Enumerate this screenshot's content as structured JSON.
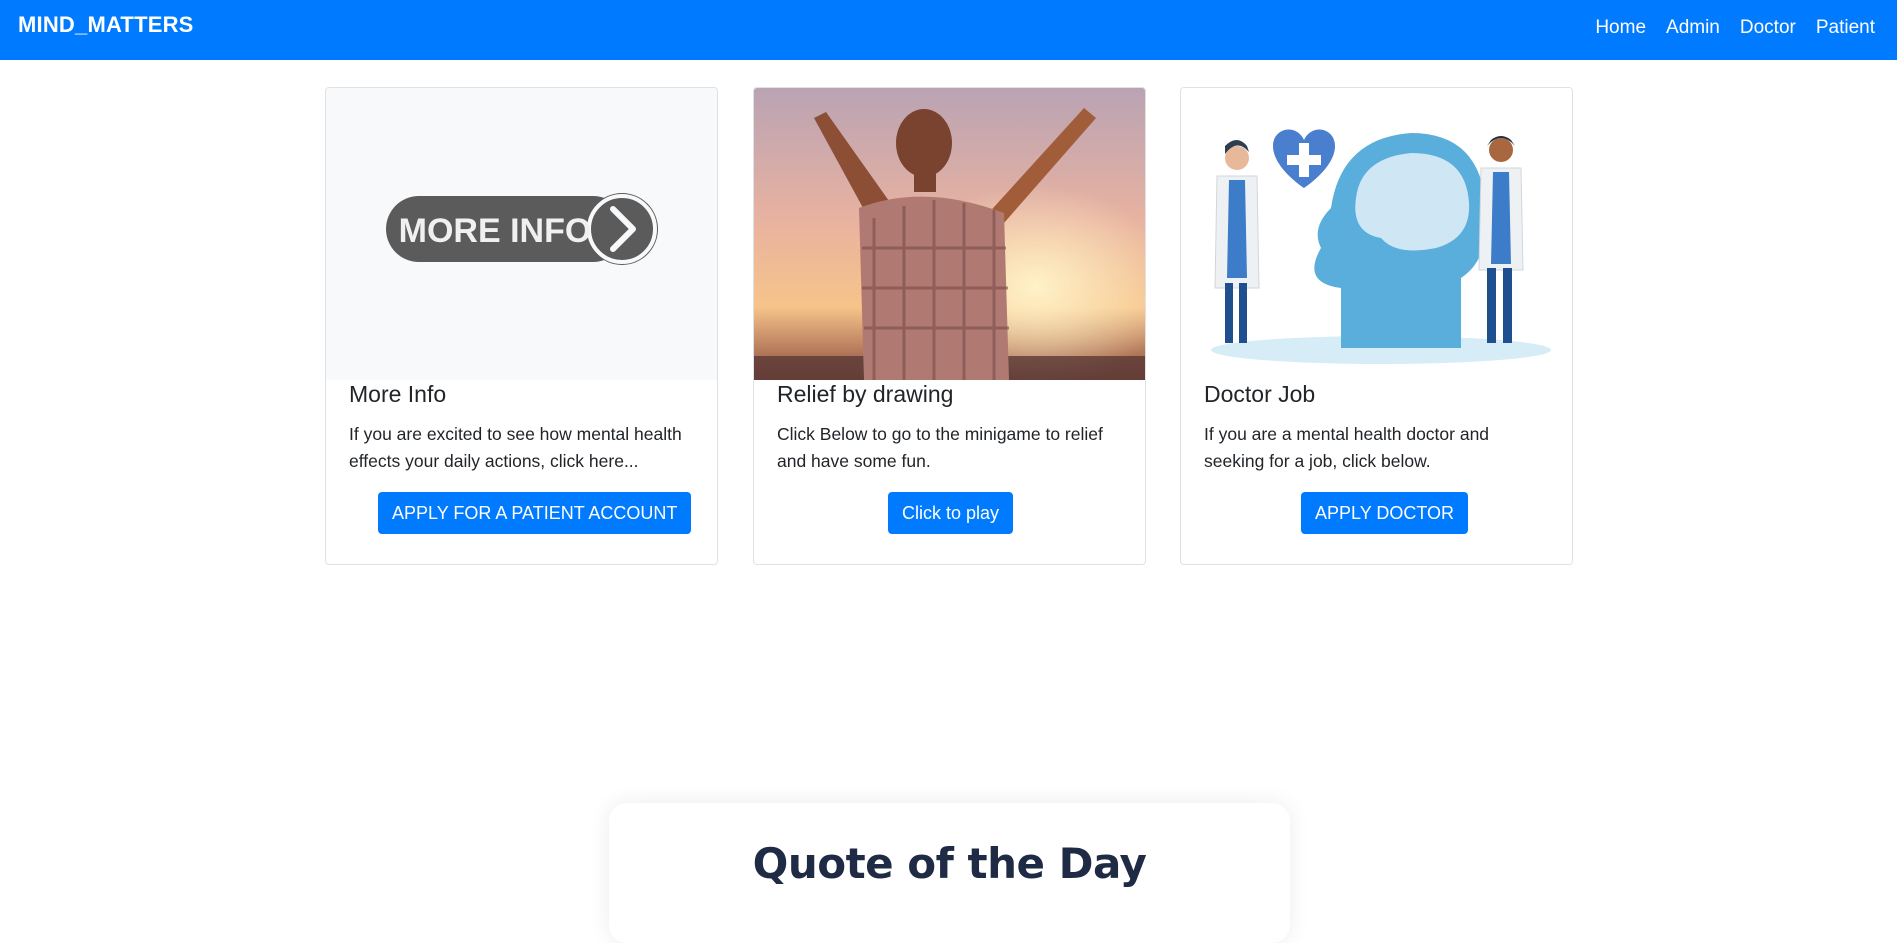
{
  "navbar": {
    "brand": "MIND_MATTERS",
    "links": [
      "Home",
      "Admin",
      "Doctor",
      "Patient"
    ],
    "color": "#007bff"
  },
  "cards": [
    {
      "image_text": "MORE INFO",
      "title": "More Info",
      "text": "If you are excited to see how mental health effects your daily actions, click here...",
      "button": "APPLY FOR A PATIENT ACCOUNT"
    },
    {
      "title": "Relief by drawing",
      "text": "Click Below to go to the minigame to relief and have some fun.",
      "button": "Click to play"
    },
    {
      "title": "Doctor Job",
      "text": "If you are a mental health doctor and seeking for a job, click below.",
      "button": "APPLY DOCTOR"
    }
  ],
  "quote": {
    "title": "Quote of the Day"
  },
  "icons": {
    "more_info": "chevron-right-icon",
    "relief": "person-sunset-image",
    "doctor": "doctors-brain-heart-illustration"
  }
}
